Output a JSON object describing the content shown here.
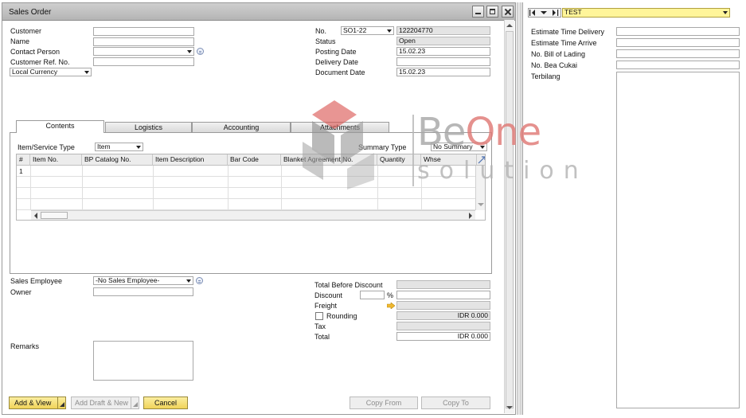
{
  "window": {
    "title": "Sales Order"
  },
  "header_left": {
    "customer": {
      "label": "Customer",
      "value": ""
    },
    "name": {
      "label": "Name",
      "value": ""
    },
    "contact_person": {
      "label": "Contact Person",
      "value": ""
    },
    "customer_ref_no": {
      "label": "Customer Ref. No.",
      "value": ""
    },
    "currency": {
      "value": "Local Currency"
    }
  },
  "header_right": {
    "no": {
      "label": "No.",
      "series": "SO1-22",
      "value": "122204770"
    },
    "status": {
      "label": "Status",
      "value": "Open"
    },
    "posting_date": {
      "label": "Posting Date",
      "value": "15.02.23"
    },
    "delivery_date": {
      "label": "Delivery Date",
      "value": ""
    },
    "document_date": {
      "label": "Document Date",
      "value": "15.02.23"
    }
  },
  "tabs": [
    {
      "label": "Contents",
      "active": true
    },
    {
      "label": "Logistics",
      "active": false
    },
    {
      "label": "Accounting",
      "active": false
    },
    {
      "label": "Attachments",
      "active": false
    }
  ],
  "contents": {
    "item_service_type": {
      "label": "Item/Service Type",
      "value": "Item"
    },
    "summary_type": {
      "label": "Summary Type",
      "value": "No Summary"
    },
    "grid": {
      "columns": [
        "#",
        "Item No.",
        "BP Catalog No.",
        "Item Description",
        "Bar Code",
        "Blanket Agreement No.",
        "Quantity",
        "Whse"
      ],
      "rows": [
        [
          "1",
          "",
          "",
          "",
          "",
          "",
          "",
          ""
        ]
      ]
    }
  },
  "footer_left": {
    "sales_employee": {
      "label": "Sales Employee",
      "value": "-No Sales Employee-"
    },
    "owner": {
      "label": "Owner",
      "value": ""
    },
    "remarks": {
      "label": "Remarks",
      "value": ""
    }
  },
  "totals": {
    "total_before_discount": {
      "label": "Total Before Discount",
      "value": ""
    },
    "discount": {
      "label": "Discount",
      "percent_sign": "%",
      "value": ""
    },
    "freight": {
      "label": "Freight",
      "value": ""
    },
    "rounding": {
      "label": "Rounding",
      "value": "IDR 0.000",
      "checked": false
    },
    "tax": {
      "label": "Tax",
      "value": ""
    },
    "total": {
      "label": "Total",
      "value": "IDR 0.000"
    }
  },
  "buttons": {
    "add_view": "Add & View",
    "add_draft_new": "Add Draft & New",
    "cancel": "Cancel",
    "copy_from": "Copy From",
    "copy_to": "Copy To"
  },
  "udf_panel": {
    "set_name": "TEST",
    "fields": [
      {
        "label": "Estimate Time Delivery",
        "value": ""
      },
      {
        "label": "Estimate Time Arrive",
        "value": ""
      },
      {
        "label": "No. Bill of Lading",
        "value": ""
      },
      {
        "label": "No. Bea Cukai",
        "value": ""
      },
      {
        "label": "Terbilang",
        "value": ""
      }
    ]
  },
  "watermark": {
    "line1_a": "Be",
    "line1_b": "One",
    "line2": "solution"
  },
  "colors": {
    "accent_yellow": "#f0d35a",
    "udf_yellow": "#fff59a",
    "watermark_red": "#d9534f",
    "watermark_gray": "#8f8f8f"
  }
}
